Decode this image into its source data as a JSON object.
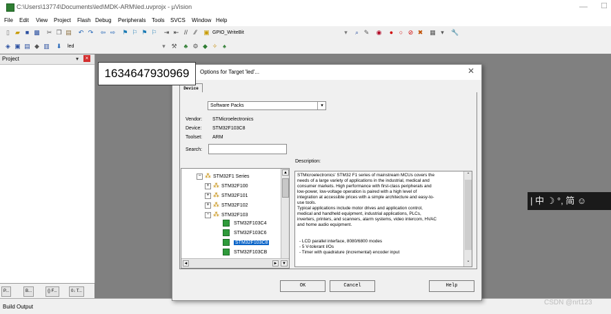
{
  "window": {
    "title": "C:\\Users\\13774\\Documents\\led\\MDK-ARM\\led.uvprojx - µVision"
  },
  "menu": [
    "File",
    "Edit",
    "View",
    "Project",
    "Flash",
    "Debug",
    "Peripherals",
    "Tools",
    "SVCS",
    "Window",
    "Help"
  ],
  "toolbar": {
    "function_combo": "GPIO_WriteBit",
    "target_combo": "led"
  },
  "project_panel": {
    "title": "Project",
    "tabs": [
      "P...",
      "B...",
      "{} F...",
      "0↓ T..."
    ]
  },
  "build_output": {
    "label": "Build Output"
  },
  "overlay": {
    "timestamp": "1634647930969"
  },
  "dialog": {
    "title": "Options for Target 'led'...",
    "tab": "Device",
    "pack_select": "Software Packs",
    "vendor_label": "Vendor:",
    "vendor_value": "STMicroelectronics",
    "device_label": "Device:",
    "device_value": "STM32F103C8",
    "toolset_label": "Toolset:",
    "toolset_value": "ARM",
    "search_label": "Search:",
    "search_value": "",
    "description_label": "Description:",
    "tree": [
      {
        "label": "STM32F1 Series",
        "level": 0,
        "expander": "-",
        "icon": "package"
      },
      {
        "label": "STM32F100",
        "level": 1,
        "expander": "+",
        "icon": "package"
      },
      {
        "label": "STM32F101",
        "level": 1,
        "expander": "+",
        "icon": "package"
      },
      {
        "label": "STM32F102",
        "level": 1,
        "expander": "+",
        "icon": "package"
      },
      {
        "label": "STM32F103",
        "level": 1,
        "expander": "-",
        "icon": "package"
      },
      {
        "label": "STM32F103C4",
        "level": 2,
        "expander": "",
        "icon": "chip"
      },
      {
        "label": "STM32F103C6",
        "level": 2,
        "expander": "",
        "icon": "chip"
      },
      {
        "label": "STM32F103C8",
        "level": 2,
        "expander": "",
        "icon": "chip",
        "selected": true
      },
      {
        "label": "STM32F103CB",
        "level": 2,
        "expander": "",
        "icon": "chip"
      }
    ],
    "description": [
      "STMicroelectronics' STM32 F1 series of mainstream MCUs covers the",
      "needs of a large variety of applications in the industrial, medical and",
      "consumer markets. High performance with first-class peripherals and",
      "low-power, low-voltage operation is paired with a high level of",
      "integration at accessible prices with a simple architecture and easy-to-",
      "use tools.",
      "Typical applications include motor drives and application control,",
      "medical and handheld equipment, industrial applications, PLCs,",
      "inverters, printers, and scanners, alarm systems, video intercom, HVAC",
      "and home audio equipment.",
      "",
      "- LCD parallel interface, 8080/6800 modes",
      "- 5 V-tolerant I/Os",
      "- Timer with quadrature (incremental) encoder input"
    ],
    "buttons": {
      "ok": "OK",
      "cancel": "Cancel",
      "help": "Help"
    }
  },
  "ime_bar": {
    "text": "| 中 ☽ °, 简 ☺"
  },
  "watermark": "CSDN @nrt123"
}
